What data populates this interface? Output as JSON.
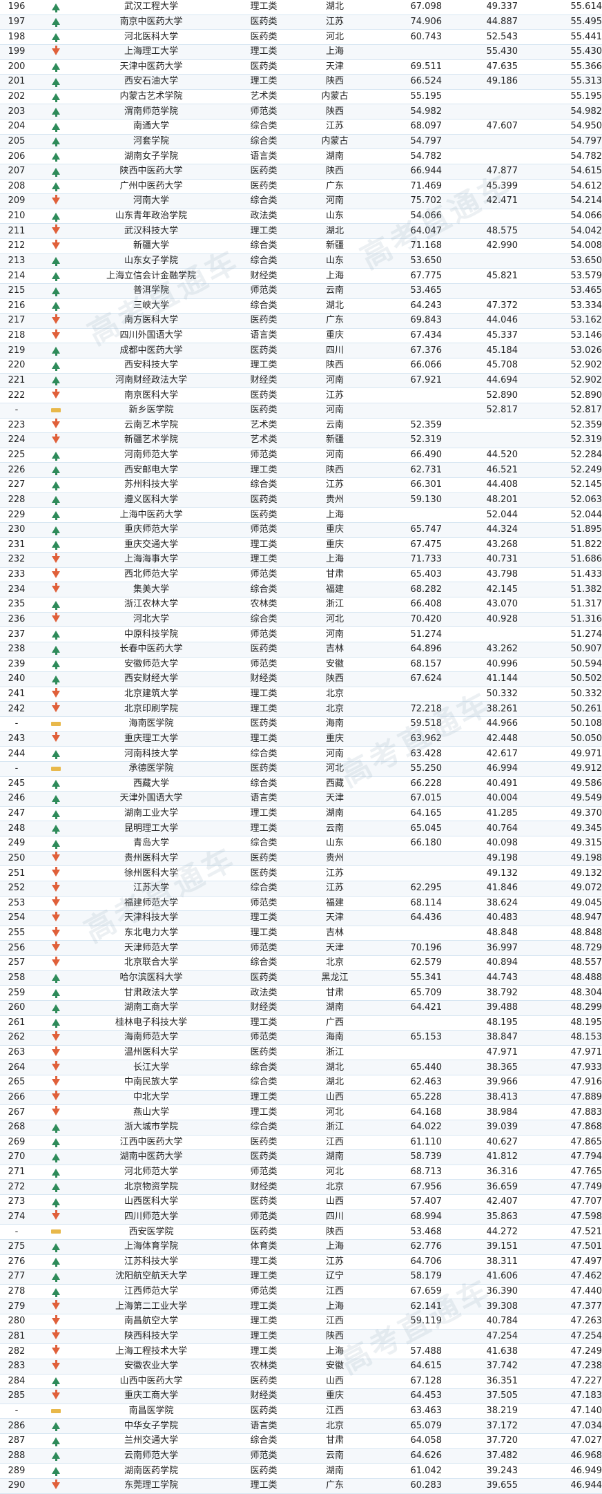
{
  "watermark": "高考直通车",
  "rows": [
    [
      "196",
      "up",
      "武汉工程大学",
      "理工类",
      "湖北",
      "67.098",
      "49.337",
      "55.614"
    ],
    [
      "197",
      "up",
      "南京中医药大学",
      "医药类",
      "江苏",
      "74.906",
      "44.887",
      "55.495"
    ],
    [
      "198",
      "up",
      "河北医科大学",
      "医药类",
      "河北",
      "60.743",
      "52.543",
      "55.441"
    ],
    [
      "199",
      "down",
      "上海理工大学",
      "理工类",
      "上海",
      "",
      "55.430",
      "55.430"
    ],
    [
      "200",
      "up",
      "天津中医药大学",
      "医药类",
      "天津",
      "69.511",
      "47.635",
      "55.366"
    ],
    [
      "201",
      "up",
      "西安石油大学",
      "理工类",
      "陕西",
      "66.524",
      "49.186",
      "55.313"
    ],
    [
      "202",
      "up",
      "内蒙古艺术学院",
      "艺术类",
      "内蒙古",
      "55.195",
      "",
      "55.195"
    ],
    [
      "203",
      "up",
      "渭南师范学院",
      "师范类",
      "陕西",
      "54.982",
      "",
      "54.982"
    ],
    [
      "204",
      "up",
      "南通大学",
      "综合类",
      "江苏",
      "68.097",
      "47.607",
      "54.950"
    ],
    [
      "205",
      "up",
      "河套学院",
      "综合类",
      "内蒙古",
      "54.797",
      "",
      "54.797"
    ],
    [
      "206",
      "up",
      "湖南女子学院",
      "语言类",
      "湖南",
      "54.782",
      "",
      "54.782"
    ],
    [
      "207",
      "up",
      "陕西中医药大学",
      "医药类",
      "陕西",
      "66.944",
      "47.877",
      "54.615"
    ],
    [
      "208",
      "up",
      "广州中医药大学",
      "医药类",
      "广东",
      "71.469",
      "45.399",
      "54.612"
    ],
    [
      "209",
      "down",
      "河南大学",
      "综合类",
      "河南",
      "75.702",
      "42.471",
      "54.214"
    ],
    [
      "210",
      "up",
      "山东青年政治学院",
      "政法类",
      "山东",
      "54.066",
      "",
      "54.066"
    ],
    [
      "211",
      "down",
      "武汉科技大学",
      "理工类",
      "湖北",
      "64.047",
      "48.575",
      "54.042"
    ],
    [
      "212",
      "down",
      "新疆大学",
      "综合类",
      "新疆",
      "71.168",
      "42.990",
      "54.008"
    ],
    [
      "213",
      "up",
      "山东女子学院",
      "综合类",
      "山东",
      "53.650",
      "",
      "53.650"
    ],
    [
      "214",
      "up",
      "上海立信会计金融学院",
      "财经类",
      "上海",
      "67.775",
      "45.821",
      "53.579"
    ],
    [
      "215",
      "up",
      "普洱学院",
      "师范类",
      "云南",
      "53.465",
      "",
      "53.465"
    ],
    [
      "216",
      "up",
      "三峡大学",
      "综合类",
      "湖北",
      "64.243",
      "47.372",
      "53.334"
    ],
    [
      "217",
      "down",
      "南方医科大学",
      "医药类",
      "广东",
      "69.843",
      "44.046",
      "53.162"
    ],
    [
      "218",
      "down",
      "四川外国语大学",
      "语言类",
      "重庆",
      "67.434",
      "45.337",
      "53.146"
    ],
    [
      "219",
      "up",
      "成都中医药大学",
      "医药类",
      "四川",
      "67.376",
      "45.184",
      "53.026"
    ],
    [
      "220",
      "up",
      "西安科技大学",
      "理工类",
      "陕西",
      "66.066",
      "45.708",
      "52.902"
    ],
    [
      "221",
      "up",
      "河南财经政法大学",
      "财经类",
      "河南",
      "67.921",
      "44.694",
      "52.902"
    ],
    [
      "222",
      "down",
      "南京医科大学",
      "医药类",
      "江苏",
      "",
      "52.890",
      "52.890"
    ],
    [
      "-",
      "flat",
      "新乡医学院",
      "医药类",
      "河南",
      "",
      "52.817",
      "52.817"
    ],
    [
      "223",
      "down",
      "云南艺术学院",
      "艺术类",
      "云南",
      "52.359",
      "",
      "52.359"
    ],
    [
      "224",
      "down",
      "新疆艺术学院",
      "艺术类",
      "新疆",
      "52.319",
      "",
      "52.319"
    ],
    [
      "225",
      "up",
      "河南师范大学",
      "师范类",
      "河南",
      "66.490",
      "44.520",
      "52.284"
    ],
    [
      "226",
      "up",
      "西安邮电大学",
      "理工类",
      "陕西",
      "62.731",
      "46.521",
      "52.249"
    ],
    [
      "227",
      "up",
      "苏州科技大学",
      "综合类",
      "江苏",
      "66.301",
      "44.408",
      "52.145"
    ],
    [
      "228",
      "up",
      "遵义医科大学",
      "医药类",
      "贵州",
      "59.130",
      "48.201",
      "52.063"
    ],
    [
      "229",
      "up",
      "上海中医药大学",
      "医药类",
      "上海",
      "",
      "52.044",
      "52.044"
    ],
    [
      "230",
      "up",
      "重庆师范大学",
      "师范类",
      "重庆",
      "65.747",
      "44.324",
      "51.895"
    ],
    [
      "231",
      "up",
      "重庆交通大学",
      "理工类",
      "重庆",
      "67.475",
      "43.268",
      "51.822"
    ],
    [
      "232",
      "down",
      "上海海事大学",
      "理工类",
      "上海",
      "71.733",
      "40.731",
      "51.686"
    ],
    [
      "233",
      "down",
      "西北师范大学",
      "师范类",
      "甘肃",
      "65.403",
      "43.798",
      "51.433"
    ],
    [
      "234",
      "down",
      "集美大学",
      "综合类",
      "福建",
      "68.282",
      "42.145",
      "51.382"
    ],
    [
      "235",
      "up",
      "浙江农林大学",
      "农林类",
      "浙江",
      "66.408",
      "43.070",
      "51.317"
    ],
    [
      "236",
      "down",
      "河北大学",
      "综合类",
      "河北",
      "70.420",
      "40.928",
      "51.316"
    ],
    [
      "237",
      "up",
      "中原科技学院",
      "师范类",
      "河南",
      "51.274",
      "",
      "51.274"
    ],
    [
      "238",
      "up",
      "长春中医药大学",
      "医药类",
      "吉林",
      "64.896",
      "43.262",
      "50.907"
    ],
    [
      "239",
      "up",
      "安徽师范大学",
      "师范类",
      "安徽",
      "68.157",
      "40.996",
      "50.594"
    ],
    [
      "240",
      "up",
      "西安财经大学",
      "财经类",
      "陕西",
      "67.624",
      "41.144",
      "50.502"
    ],
    [
      "241",
      "down",
      "北京建筑大学",
      "理工类",
      "北京",
      "",
      "50.332",
      "50.332"
    ],
    [
      "242",
      "down",
      "北京印刷学院",
      "理工类",
      "北京",
      "72.218",
      "38.261",
      "50.261"
    ],
    [
      "-",
      "flat",
      "海南医学院",
      "医药类",
      "海南",
      "59.518",
      "44.966",
      "50.108"
    ],
    [
      "243",
      "down",
      "重庆理工大学",
      "理工类",
      "重庆",
      "63.962",
      "42.448",
      "50.050"
    ],
    [
      "244",
      "up",
      "河南科技大学",
      "综合类",
      "河南",
      "63.428",
      "42.617",
      "49.971"
    ],
    [
      "-",
      "flat",
      "承德医学院",
      "医药类",
      "河北",
      "55.250",
      "46.994",
      "49.912"
    ],
    [
      "245",
      "up",
      "西藏大学",
      "综合类",
      "西藏",
      "66.228",
      "40.491",
      "49.586"
    ],
    [
      "246",
      "up",
      "天津外国语大学",
      "语言类",
      "天津",
      "67.015",
      "40.004",
      "49.549"
    ],
    [
      "247",
      "up",
      "湖南工业大学",
      "理工类",
      "湖南",
      "64.165",
      "41.285",
      "49.370"
    ],
    [
      "248",
      "up",
      "昆明理工大学",
      "理工类",
      "云南",
      "65.045",
      "40.764",
      "49.345"
    ],
    [
      "249",
      "up",
      "青岛大学",
      "综合类",
      "山东",
      "66.180",
      "40.098",
      "49.315"
    ],
    [
      "250",
      "down",
      "贵州医科大学",
      "医药类",
      "贵州",
      "",
      "49.198",
      "49.198"
    ],
    [
      "251",
      "down",
      "徐州医科大学",
      "医药类",
      "江苏",
      "",
      "49.132",
      "49.132"
    ],
    [
      "252",
      "down",
      "江苏大学",
      "综合类",
      "江苏",
      "62.295",
      "41.846",
      "49.072"
    ],
    [
      "253",
      "down",
      "福建师范大学",
      "师范类",
      "福建",
      "68.114",
      "38.624",
      "49.045"
    ],
    [
      "254",
      "down",
      "天津科技大学",
      "理工类",
      "天津",
      "64.436",
      "40.483",
      "48.947"
    ],
    [
      "255",
      "down",
      "东北电力大学",
      "理工类",
      "吉林",
      "",
      "48.848",
      "48.848"
    ],
    [
      "256",
      "down",
      "天津师范大学",
      "师范类",
      "天津",
      "70.196",
      "36.997",
      "48.729"
    ],
    [
      "257",
      "down",
      "北京联合大学",
      "综合类",
      "北京",
      "62.579",
      "40.894",
      "48.557"
    ],
    [
      "258",
      "up",
      "哈尔滨医科大学",
      "医药类",
      "黑龙江",
      "55.341",
      "44.743",
      "48.488"
    ],
    [
      "259",
      "up",
      "甘肃政法大学",
      "政法类",
      "甘肃",
      "65.709",
      "38.792",
      "48.304"
    ],
    [
      "260",
      "up",
      "湖南工商大学",
      "财经类",
      "湖南",
      "64.421",
      "39.488",
      "48.299"
    ],
    [
      "261",
      "up",
      "桂林电子科技大学",
      "理工类",
      "广西",
      "",
      "48.195",
      "48.195"
    ],
    [
      "262",
      "down",
      "海南师范大学",
      "师范类",
      "海南",
      "65.153",
      "38.847",
      "48.153"
    ],
    [
      "263",
      "down",
      "温州医科大学",
      "医药类",
      "浙江",
      "",
      "47.971",
      "47.971"
    ],
    [
      "264",
      "down",
      "长江大学",
      "综合类",
      "湖北",
      "65.440",
      "38.365",
      "47.933"
    ],
    [
      "265",
      "down",
      "中南民族大学",
      "综合类",
      "湖北",
      "62.463",
      "39.966",
      "47.916"
    ],
    [
      "266",
      "down",
      "中北大学",
      "理工类",
      "山西",
      "65.228",
      "38.413",
      "47.889"
    ],
    [
      "267",
      "down",
      "燕山大学",
      "理工类",
      "河北",
      "64.168",
      "38.984",
      "47.883"
    ],
    [
      "268",
      "up",
      "浙大城市学院",
      "综合类",
      "浙江",
      "64.022",
      "39.039",
      "47.868"
    ],
    [
      "269",
      "up",
      "江西中医药大学",
      "医药类",
      "江西",
      "61.110",
      "40.627",
      "47.865"
    ],
    [
      "270",
      "up",
      "湖南中医药大学",
      "医药类",
      "湖南",
      "58.739",
      "41.812",
      "47.794"
    ],
    [
      "271",
      "up",
      "河北师范大学",
      "师范类",
      "河北",
      "68.713",
      "36.316",
      "47.765"
    ],
    [
      "272",
      "up",
      "北京物资学院",
      "财经类",
      "北京",
      "67.956",
      "36.659",
      "47.749"
    ],
    [
      "273",
      "up",
      "山西医科大学",
      "医药类",
      "山西",
      "57.407",
      "42.407",
      "47.707"
    ],
    [
      "274",
      "down",
      "四川师范大学",
      "师范类",
      "四川",
      "68.994",
      "35.863",
      "47.598"
    ],
    [
      "-",
      "flat",
      "西安医学院",
      "医药类",
      "陕西",
      "53.468",
      "44.272",
      "47.521"
    ],
    [
      "275",
      "up",
      "上海体育学院",
      "体育类",
      "上海",
      "62.776",
      "39.151",
      "47.501"
    ],
    [
      "276",
      "up",
      "江苏科技大学",
      "理工类",
      "江苏",
      "64.706",
      "38.311",
      "47.497"
    ],
    [
      "277",
      "up",
      "沈阳航空航天大学",
      "理工类",
      "辽宁",
      "58.179",
      "41.606",
      "47.462"
    ],
    [
      "278",
      "up",
      "江西师范大学",
      "师范类",
      "江西",
      "67.659",
      "36.390",
      "47.440"
    ],
    [
      "279",
      "down",
      "上海第二工业大学",
      "理工类",
      "上海",
      "62.141",
      "39.308",
      "47.377"
    ],
    [
      "280",
      "down",
      "南昌航空大学",
      "理工类",
      "江西",
      "59.119",
      "40.784",
      "47.263"
    ],
    [
      "281",
      "down",
      "陕西科技大学",
      "理工类",
      "陕西",
      "",
      "47.254",
      "47.254"
    ],
    [
      "282",
      "down",
      "上海工程技术大学",
      "理工类",
      "上海",
      "57.488",
      "41.638",
      "47.249"
    ],
    [
      "283",
      "down",
      "安徽农业大学",
      "农林类",
      "安徽",
      "64.615",
      "37.742",
      "47.238"
    ],
    [
      "284",
      "up",
      "山西中医药大学",
      "医药类",
      "山西",
      "67.128",
      "36.351",
      "47.227"
    ],
    [
      "285",
      "down",
      "重庆工商大学",
      "财经类",
      "重庆",
      "64.453",
      "37.505",
      "47.183"
    ],
    [
      "-",
      "flat",
      "南昌医学院",
      "医药类",
      "江西",
      "63.463",
      "38.219",
      "47.140"
    ],
    [
      "286",
      "up",
      "中华女子学院",
      "语言类",
      "北京",
      "65.079",
      "37.172",
      "47.034"
    ],
    [
      "287",
      "up",
      "兰州交通大学",
      "综合类",
      "甘肃",
      "64.058",
      "37.720",
      "47.027"
    ],
    [
      "288",
      "up",
      "云南师范大学",
      "师范类",
      "云南",
      "64.626",
      "37.482",
      "46.968"
    ],
    [
      "289",
      "up",
      "湖南医药学院",
      "医药类",
      "湖南",
      "61.042",
      "39.243",
      "46.949"
    ],
    [
      "290",
      "down",
      "东莞理工学院",
      "理工类",
      "广东",
      "60.283",
      "39.655",
      "46.944"
    ]
  ]
}
